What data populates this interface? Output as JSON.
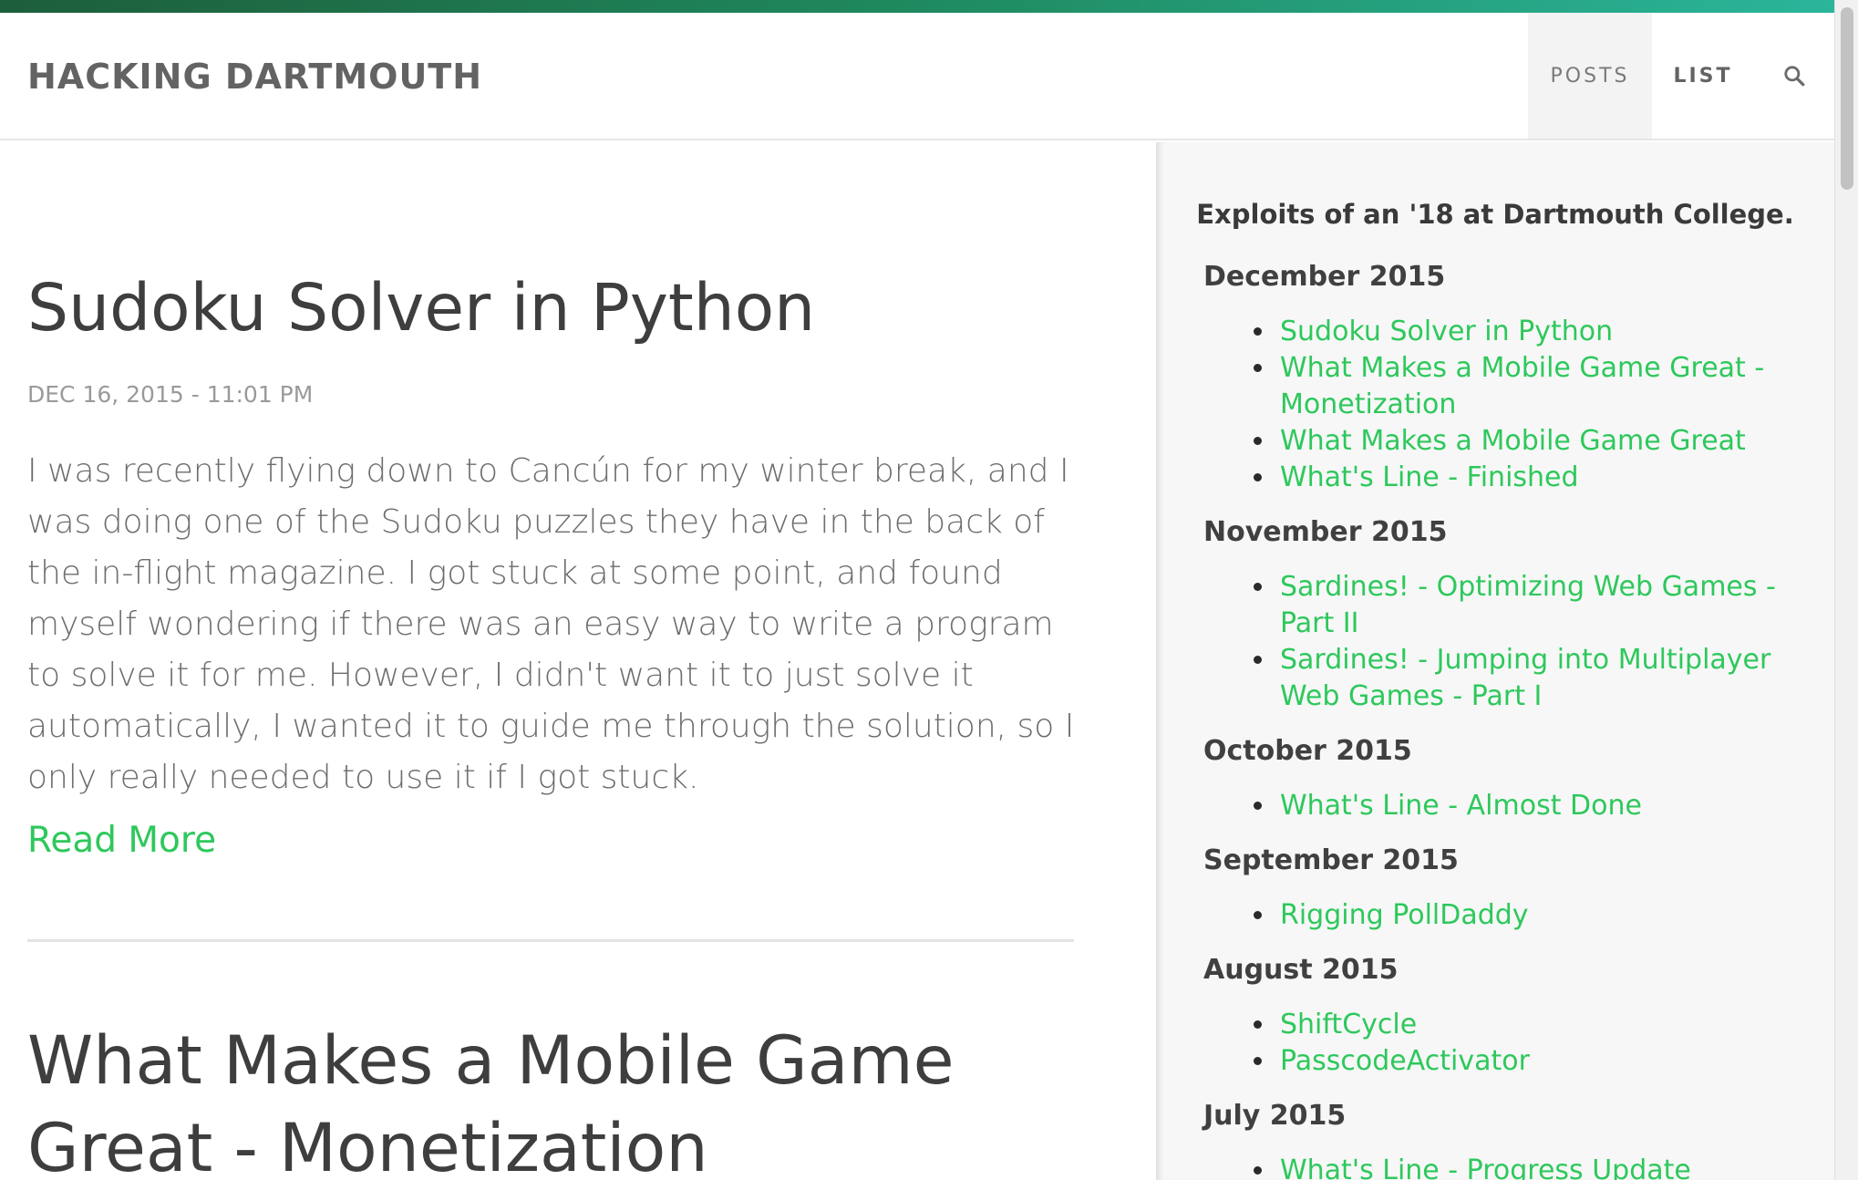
{
  "navbar": {
    "brand": "HACKING DARTMOUTH",
    "items": [
      {
        "label": "POSTS"
      },
      {
        "label": "LIST"
      }
    ],
    "search_icon": "search-icon"
  },
  "posts": [
    {
      "title": "Sudoku Solver in Python",
      "date": "DEC 16, 2015 - 11:01 PM",
      "excerpt": "I was recently flying down to Cancún for my winter break, and I was doing one of the Sudoku puzzles they have in the back of the in-flight magazine. I got stuck at some point, and found myself wondering if there was an easy way to write a program to solve it for me. However, I didn't want it to just solve it automatically, I wanted it to guide me through the solution, so I only really needed to use it if I got stuck.",
      "read_more": "Read More"
    },
    {
      "title": "What Makes a Mobile Game Great - Monetization"
    }
  ],
  "sidebar": {
    "tagline": "Exploits of an '18 at Dartmouth College.",
    "archive": [
      {
        "month": "December 2015",
        "posts": [
          "Sudoku Solver in Python",
          "What Makes a Mobile Game Great - Monetization",
          "What Makes a Mobile Game Great",
          "What's Line - Finished"
        ]
      },
      {
        "month": "November 2015",
        "posts": [
          "Sardines! - Optimizing Web Games - Part II",
          "Sardines! - Jumping into Multiplayer Web Games - Part I"
        ]
      },
      {
        "month": "October 2015",
        "posts": [
          "What's Line - Almost Done"
        ]
      },
      {
        "month": "September 2015",
        "posts": [
          "Rigging PollDaddy"
        ]
      },
      {
        "month": "August 2015",
        "posts": [
          "ShiftCycle",
          "PasscodeActivator"
        ]
      },
      {
        "month": "July 2015",
        "posts": [
          "What's Line - Progress Update"
        ]
      }
    ]
  },
  "colors": {
    "accent_green": "#2ec85c",
    "top_bar_start": "#1d5e3b",
    "top_bar_end": "#2bb59a"
  }
}
